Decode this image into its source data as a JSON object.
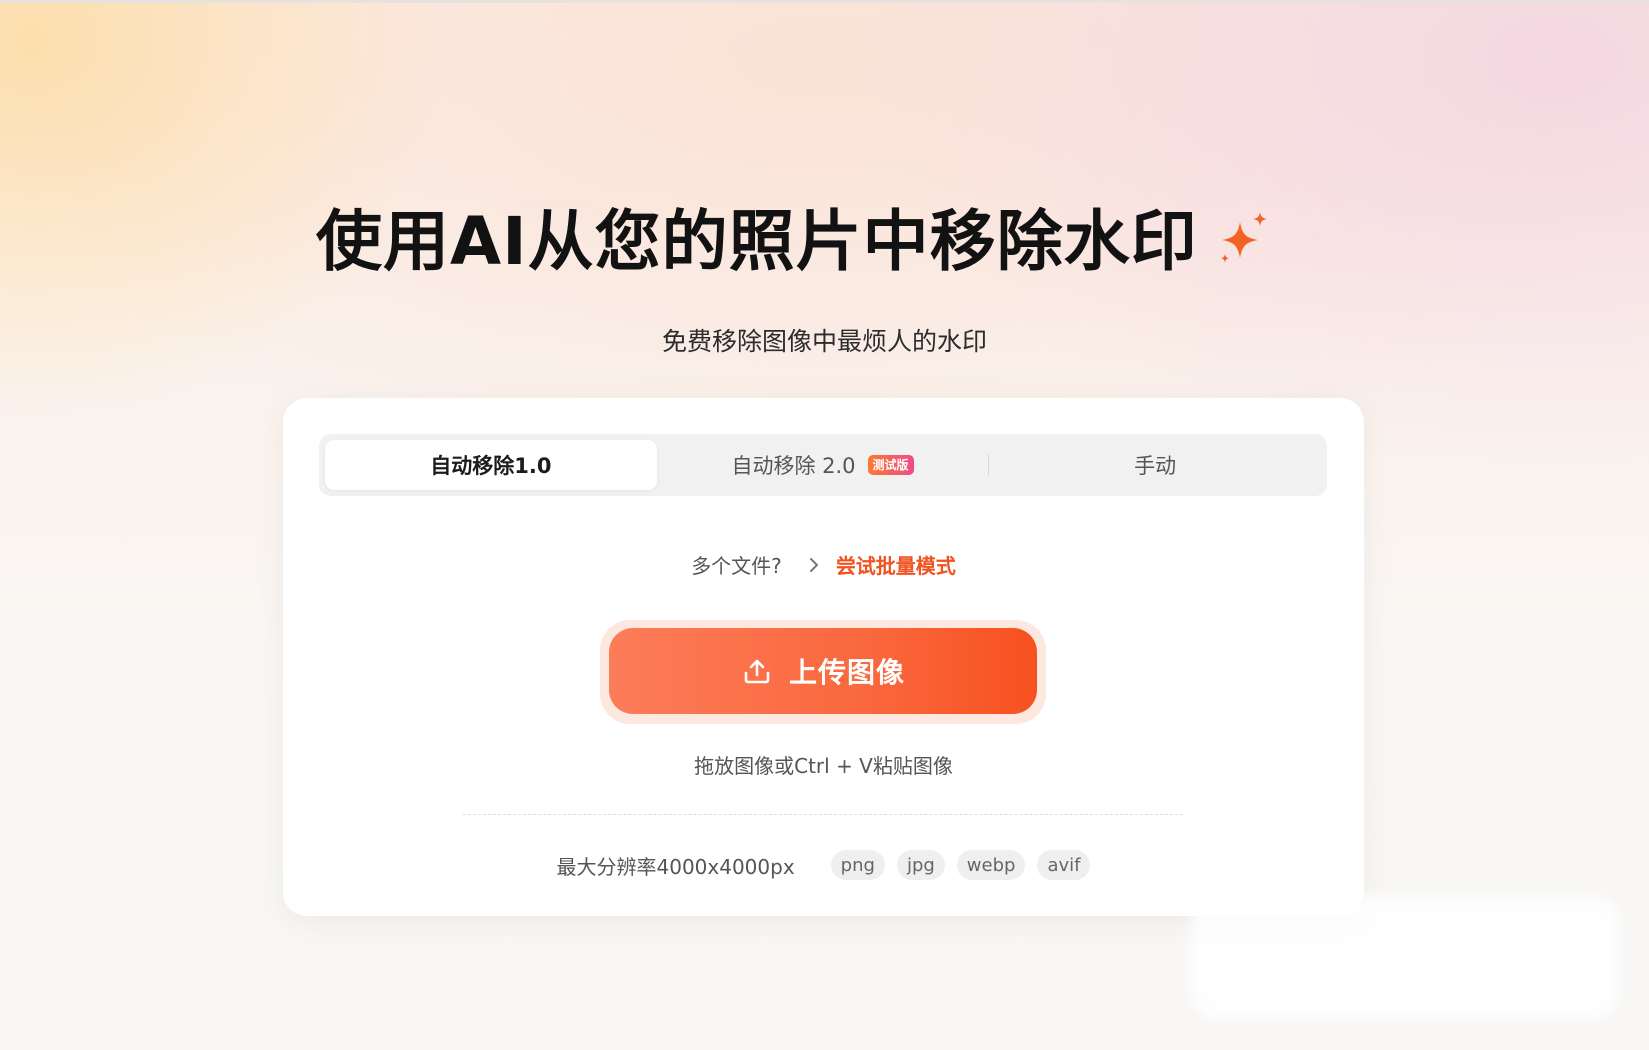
{
  "hero": {
    "title": "使用AI从您的照片中移除水印",
    "subtitle": "免费移除图像中最烦人的水印",
    "sparkle_color": "#f26324"
  },
  "tabs": [
    {
      "label": "自动移除1.0",
      "active": true
    },
    {
      "label": "自动移除 2.0",
      "badge": "测试版",
      "active": false
    },
    {
      "label": "手动",
      "active": false
    }
  ],
  "batch": {
    "question": "多个文件?",
    "link": "尝试批量模式"
  },
  "upload": {
    "button_label": "上传图像",
    "hint": "拖放图像或Ctrl + V粘贴图像"
  },
  "limits": {
    "max_resolution": "最大分辨率4000x4000px",
    "formats": [
      "png",
      "jpg",
      "webp",
      "avif"
    ]
  },
  "colors": {
    "accent": "#f0531f",
    "button_start": "#fc7c59",
    "button_end": "#f7511f"
  }
}
